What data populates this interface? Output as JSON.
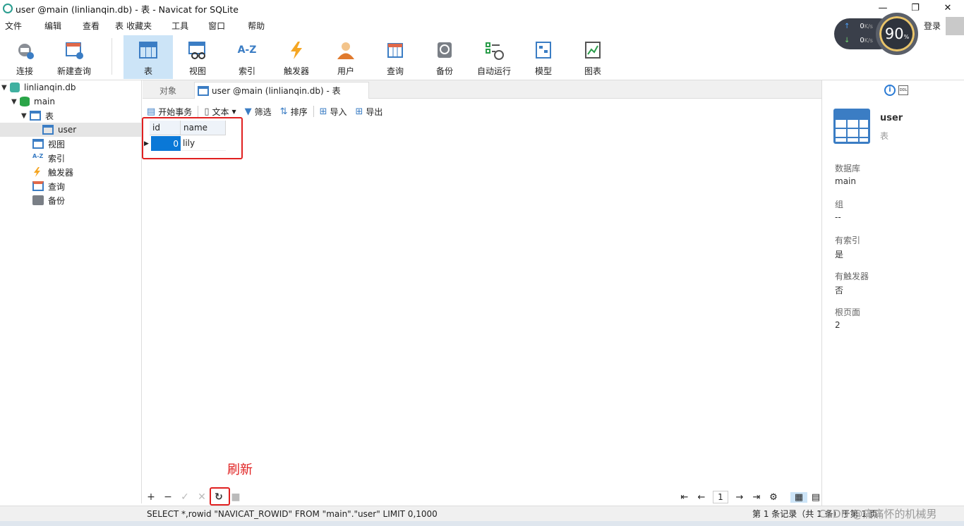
{
  "window": {
    "title": "user @main (linlianqin.db) - 表 - Navicat for SQLite",
    "min": "—",
    "max": "❐",
    "close": "✕"
  },
  "menu": [
    "文件",
    "编辑",
    "查看",
    "表",
    "收藏夹",
    "工具",
    "窗口",
    "帮助"
  ],
  "netspeed": {
    "up": "0",
    "up_unit": "K/s",
    "down": "0",
    "down_unit": "K/s",
    "percent": "90",
    "percent_unit": "%"
  },
  "account": {
    "login": "登录"
  },
  "toolbar": [
    {
      "label": "连接",
      "icon": "plug-icon"
    },
    {
      "label": "新建查询",
      "icon": "new-query-icon"
    },
    {
      "label": "表",
      "icon": "table-icon",
      "active": true
    },
    {
      "label": "视图",
      "icon": "view-icon"
    },
    {
      "label": "索引",
      "icon": "index-icon",
      "glyph": "A-Z"
    },
    {
      "label": "触发器",
      "icon": "trigger-icon"
    },
    {
      "label": "用户",
      "icon": "user-icon"
    },
    {
      "label": "查询",
      "icon": "query-icon"
    },
    {
      "label": "备份",
      "icon": "backup-icon"
    },
    {
      "label": "自动运行",
      "icon": "automation-icon"
    },
    {
      "label": "模型",
      "icon": "model-icon"
    },
    {
      "label": "图表",
      "icon": "chart-icon"
    }
  ],
  "navigator": {
    "db": "linlianqin.db",
    "schema": "main",
    "tables_node": "表",
    "table_user": "user",
    "views": "视图",
    "indexes": "索引",
    "index_glyph": "A-Z",
    "triggers": "触发器",
    "queries": "查询",
    "backups": "备份"
  },
  "tabs": {
    "objects": "对象",
    "active": "user @main (linlianqin.db) - 表"
  },
  "subtoolbar": {
    "begin_tx": "开始事务",
    "text": "文本",
    "filter": "筛选",
    "sort": "排序",
    "import": "导入",
    "export": "导出"
  },
  "grid": {
    "columns": [
      "id",
      "name"
    ],
    "rows": [
      [
        "0",
        "lily"
      ]
    ]
  },
  "annotation": "刷新",
  "bottom": {
    "page": "1"
  },
  "status": {
    "sql": "SELECT *,rowid \"NAVICAT_ROWID\" FROM \"main\".\"user\" LIMIT 0,1000",
    "count": "第 1 条记录（共 1 条）于第 1 页",
    "watermark": "CSDN @痛痛怀的机械男"
  },
  "sidepanel": {
    "name": "user",
    "kind": "表",
    "fields": [
      {
        "key": "数据库",
        "value": "main"
      },
      {
        "key": "组",
        "value": "--"
      },
      {
        "key": "有索引",
        "value": "是"
      },
      {
        "key": "有触发器",
        "value": "否"
      },
      {
        "key": "根页面",
        "value": "2"
      }
    ]
  },
  "colors": {
    "accent": "#3b7dc4",
    "selected_cell": "#0a78d7",
    "annotation": "#e02020",
    "active_tool": "#cce4f7"
  }
}
